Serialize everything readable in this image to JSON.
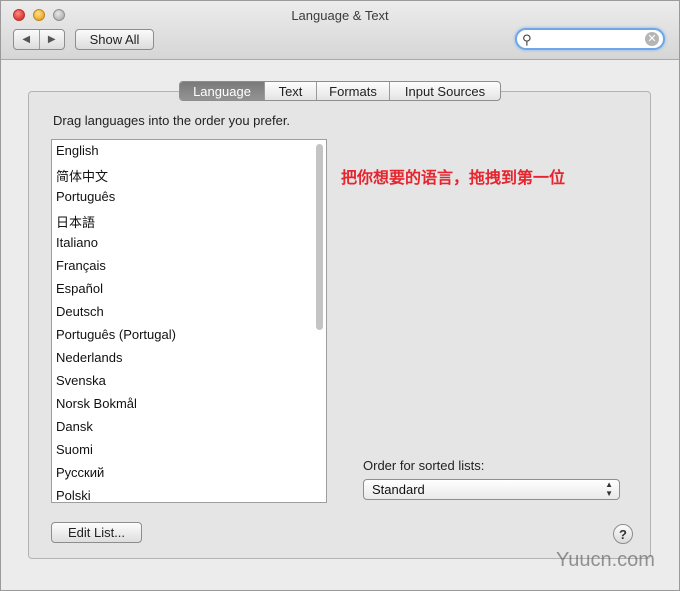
{
  "window": {
    "title": "Language & Text"
  },
  "toolbar": {
    "back_glyph": "◀",
    "forward_glyph": "▶",
    "show_all_label": "Show All",
    "search_icon": "⚲",
    "search_value": "",
    "search_clear_glyph": "✕"
  },
  "tabs": [
    {
      "label": "Language",
      "active": true
    },
    {
      "label": "Text",
      "active": false
    },
    {
      "label": "Formats",
      "active": false
    },
    {
      "label": "Input Sources",
      "active": false
    }
  ],
  "language": {
    "instructions": "Drag languages into the order you prefer.",
    "items": [
      "English",
      "简体中文",
      "Português",
      "日本語",
      "Italiano",
      "Français",
      "Español",
      "Deutsch",
      "Português (Portugal)",
      "Nederlands",
      "Svenska",
      "Norsk Bokmål",
      "Dansk",
      "Suomi",
      "Русский",
      "Polski"
    ],
    "annotation": "把你想要的语言，拖拽到第一位",
    "order_label": "Order for sorted lists:",
    "order_value": "Standard",
    "edit_label": "Edit List...",
    "help_label": "?"
  },
  "watermark": "Yuucn.com",
  "colors": {
    "annotation": "#e6252f",
    "search_focus": "#6ea6e6",
    "active_tab": "#7f7f7f"
  }
}
